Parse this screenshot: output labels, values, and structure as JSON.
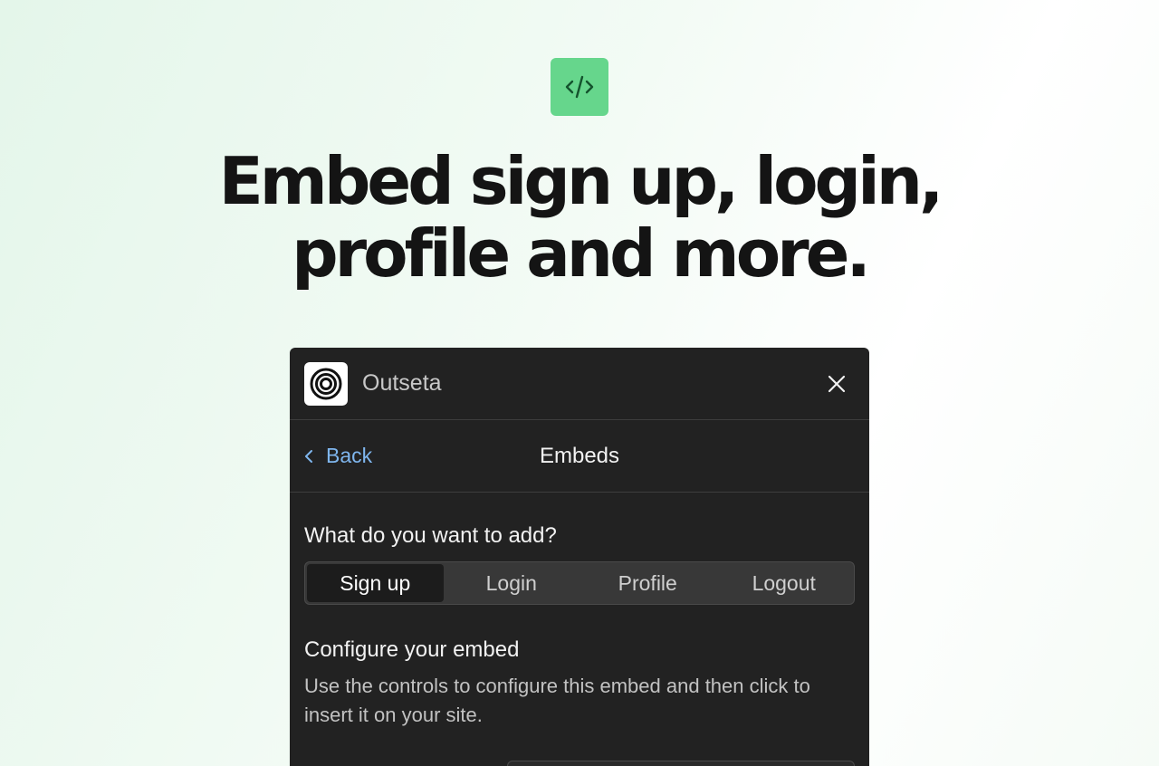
{
  "hero": {
    "icon": "code-icon",
    "title_line1": "Embed sign up, login,",
    "title_line2": "profile and more."
  },
  "panel": {
    "logo_icon": "outseta-logo-icon",
    "app_name": "Outseta",
    "close_icon": "close-icon",
    "nav": {
      "back_label": "Back",
      "title": "Embeds"
    },
    "question": "What do you want to add?",
    "options": [
      {
        "label": "Sign up",
        "selected": true
      },
      {
        "label": "Login",
        "selected": false
      },
      {
        "label": "Profile",
        "selected": false
      },
      {
        "label": "Logout",
        "selected": false
      }
    ],
    "config": {
      "title": "Configure your embed",
      "description": "Use the controls to configure this embed and then click to insert it on your site."
    }
  },
  "colors": {
    "accent_green": "#66d68c",
    "panel_bg": "#222222",
    "link_blue": "#7fb6ee"
  }
}
